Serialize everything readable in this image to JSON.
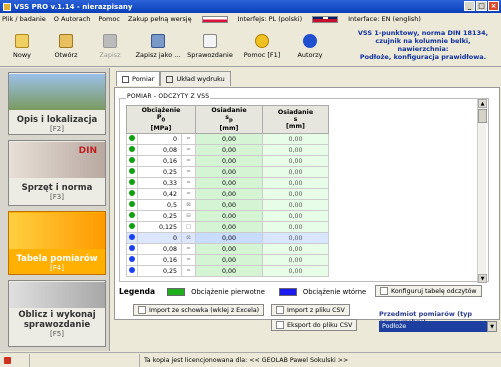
{
  "window": {
    "title": "VSS PRO v.1.14 - nierazpisany"
  },
  "menu": {
    "items": [
      "Plik / badanie",
      "O Autorach",
      "Pomoc",
      "Zakup pełną wersję",
      "Interfejs: PL (polski)",
      "Interface: EN (english)"
    ]
  },
  "toolbar": {
    "items": [
      {
        "label": "Nowy",
        "disabled": false
      },
      {
        "label": "Otwórz",
        "disabled": false
      },
      {
        "label": "Zapisz",
        "disabled": true
      },
      {
        "label": "Zapisz jako ...",
        "disabled": false
      },
      {
        "label": "Sprawozdanie",
        "disabled": false
      },
      {
        "label": "Pomoc [F1]",
        "disabled": false
      },
      {
        "label": "Autorzy",
        "disabled": false
      }
    ],
    "info_lines": [
      "VSS 1-punktowy, norma DIN 18134,",
      "czujnik na kolumnie belki, nawierzchnia:",
      "Podłoże, konfiguracja prawidłowa."
    ]
  },
  "nav": [
    {
      "label": "Opis i lokalizacja",
      "sub": "[F2]",
      "active": false
    },
    {
      "label": "Sprzęt i norma",
      "sub": "[F3]",
      "active": false,
      "img_text": "DIN"
    },
    {
      "label": "Tabela pomiarów",
      "sub": "[F4]",
      "active": true
    },
    {
      "label": "Oblicz i wykonaj sprawozdanie",
      "sub": "[F5]",
      "active": false
    }
  ],
  "tabs": [
    {
      "label": "Pomiar",
      "active": true
    },
    {
      "label": "Układ wydruku",
      "active": false
    }
  ],
  "group_label": "POMIAR - ODCZYTY Z VSS",
  "table": {
    "headers": {
      "p0": "Obciążenie\nP0\n[MPa]",
      "s": "Osiadanie\ns\n[mm]",
      "s2": "Osiadanie\ns\n[mm]"
    },
    "rows": [
      {
        "status": "green",
        "p": "0",
        "check": "=",
        "q": "0,00",
        "s": "0,00"
      },
      {
        "status": "green",
        "p": "0,08",
        "check": "=",
        "q": "0,00",
        "s": "0,00"
      },
      {
        "status": "green",
        "p": "0,16",
        "check": "=",
        "q": "0,00",
        "s": "0,00"
      },
      {
        "status": "green",
        "p": "0,25",
        "check": "=",
        "q": "0,00",
        "s": "0,00"
      },
      {
        "status": "green",
        "p": "0,33",
        "check": "=",
        "q": "0,00",
        "s": "0,00"
      },
      {
        "status": "green",
        "p": "0,42",
        "check": "=",
        "q": "0,00",
        "s": "0,00"
      },
      {
        "status": "green",
        "p": "0,5",
        "check": "⊠",
        "q": "0,00",
        "s": "0,00"
      },
      {
        "status": "green",
        "p": "0,25",
        "check": "⊟",
        "q": "0,00",
        "s": "0,00"
      },
      {
        "status": "green",
        "p": "0,125",
        "check": "□",
        "q": "0,00",
        "s": "0,00"
      },
      {
        "status": "blue",
        "p": "0",
        "check": "⊠",
        "q": "0,00",
        "s": "0,00"
      },
      {
        "status": "blue",
        "p": "0,08",
        "check": "=",
        "q": "0,00",
        "s": "0,00"
      },
      {
        "status": "blue",
        "p": "0,16",
        "check": "=",
        "q": "0,00",
        "s": "0,00"
      },
      {
        "status": "blue",
        "p": "0,25",
        "check": "=",
        "q": "0,00",
        "s": "0,00"
      }
    ]
  },
  "legend": {
    "title": "Legenda",
    "primary": "Obciążenie pierwotne",
    "secondary": "Obciążenie wtórne",
    "primary_color": "#1bb01b",
    "secondary_color": "#1a1af0"
  },
  "buttons": {
    "configure": "Konfiguruj tabelę odczytów",
    "import_excel": "Import ze schowka (wklej z Excela)",
    "import_csv": "Import z pliku CSV",
    "export_csv": "Eksport do pliku CSV"
  },
  "measure_select": {
    "label": "Przedmiot pomiarów (typ nawierzchni)",
    "value": "Podłoże"
  },
  "status": {
    "text": "Ta kopia jest licencjonowana dla: << GEOLAB Pawel Sokulski >>"
  }
}
